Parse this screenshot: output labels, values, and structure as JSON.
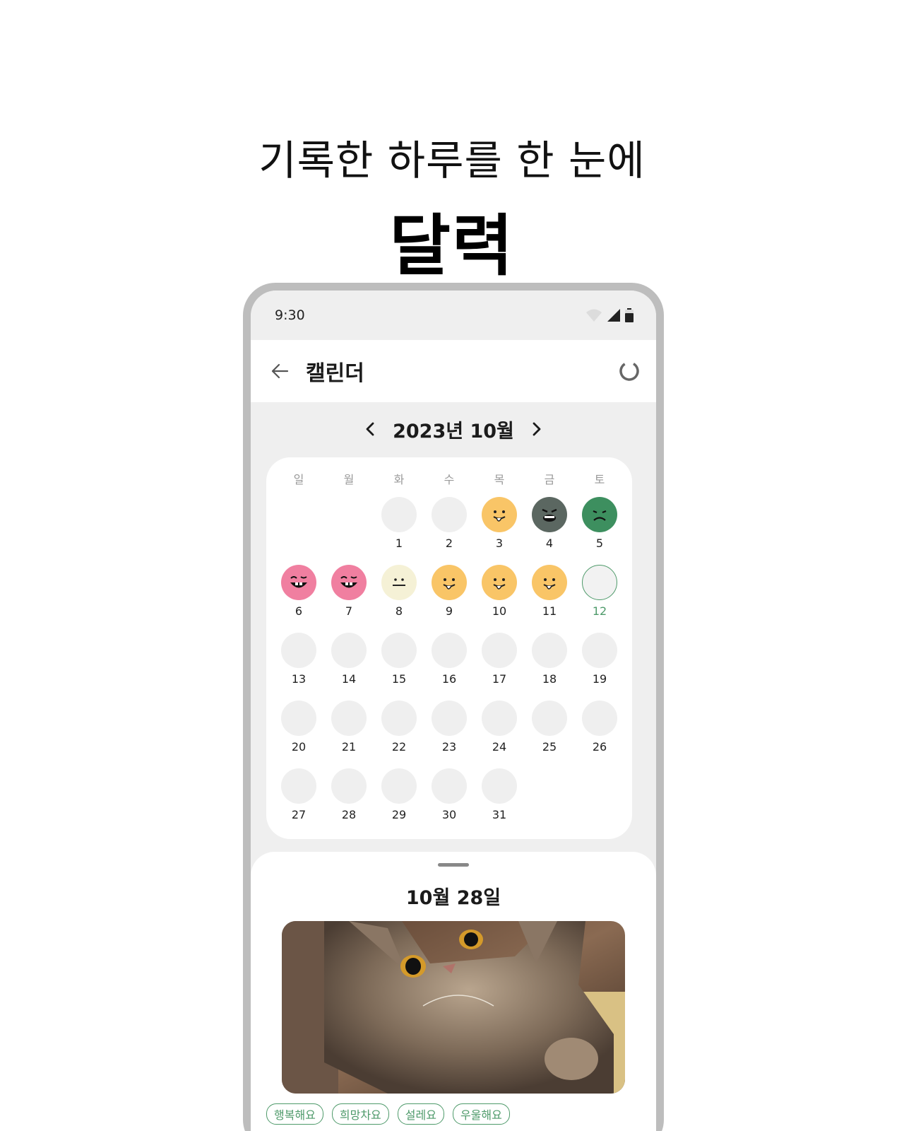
{
  "promo": {
    "headline": "기록한 하루를 한 눈에",
    "headline_bold": "달력"
  },
  "status": {
    "time": "9:30"
  },
  "appbar": {
    "title": "캘린더"
  },
  "calendar": {
    "month_label": "2023년 10월",
    "weekdays": [
      "일",
      "월",
      "화",
      "수",
      "목",
      "금",
      "토"
    ],
    "leading_blanks": 2,
    "today": 12,
    "days": [
      {
        "n": "1",
        "mood": "none"
      },
      {
        "n": "2",
        "mood": "none"
      },
      {
        "n": "3",
        "mood": "silly-yellow"
      },
      {
        "n": "4",
        "mood": "grumpy-gray"
      },
      {
        "n": "5",
        "mood": "sad-green"
      },
      {
        "n": "6",
        "mood": "wink-pink"
      },
      {
        "n": "7",
        "mood": "wink-pink"
      },
      {
        "n": "8",
        "mood": "neutral-cream"
      },
      {
        "n": "9",
        "mood": "silly-yellow"
      },
      {
        "n": "10",
        "mood": "silly-yellow"
      },
      {
        "n": "11",
        "mood": "silly-yellow"
      },
      {
        "n": "12",
        "mood": "today"
      },
      {
        "n": "13",
        "mood": "none"
      },
      {
        "n": "14",
        "mood": "none"
      },
      {
        "n": "15",
        "mood": "none"
      },
      {
        "n": "16",
        "mood": "none"
      },
      {
        "n": "17",
        "mood": "none"
      },
      {
        "n": "18",
        "mood": "none"
      },
      {
        "n": "19",
        "mood": "none"
      },
      {
        "n": "20",
        "mood": "none"
      },
      {
        "n": "21",
        "mood": "none"
      },
      {
        "n": "22",
        "mood": "none"
      },
      {
        "n": "23",
        "mood": "none"
      },
      {
        "n": "24",
        "mood": "none"
      },
      {
        "n": "25",
        "mood": "none"
      },
      {
        "n": "26",
        "mood": "none"
      },
      {
        "n": "27",
        "mood": "none"
      },
      {
        "n": "28",
        "mood": "none"
      },
      {
        "n": "29",
        "mood": "none"
      },
      {
        "n": "30",
        "mood": "none"
      },
      {
        "n": "31",
        "mood": "none"
      }
    ]
  },
  "mood_colors": {
    "silly-yellow": "#f9c567",
    "grumpy-gray": "#5b6761",
    "sad-green": "#3d8f5f",
    "wink-pink": "#f07fa0",
    "neutral-cream": "#f5f1d6"
  },
  "sheet": {
    "date": "10월 28일",
    "photo_icon": "cat-photo",
    "tags": [
      "행복해요",
      "희망차요",
      "설레요",
      "우울해요"
    ]
  },
  "accent": "#4e9a6a"
}
